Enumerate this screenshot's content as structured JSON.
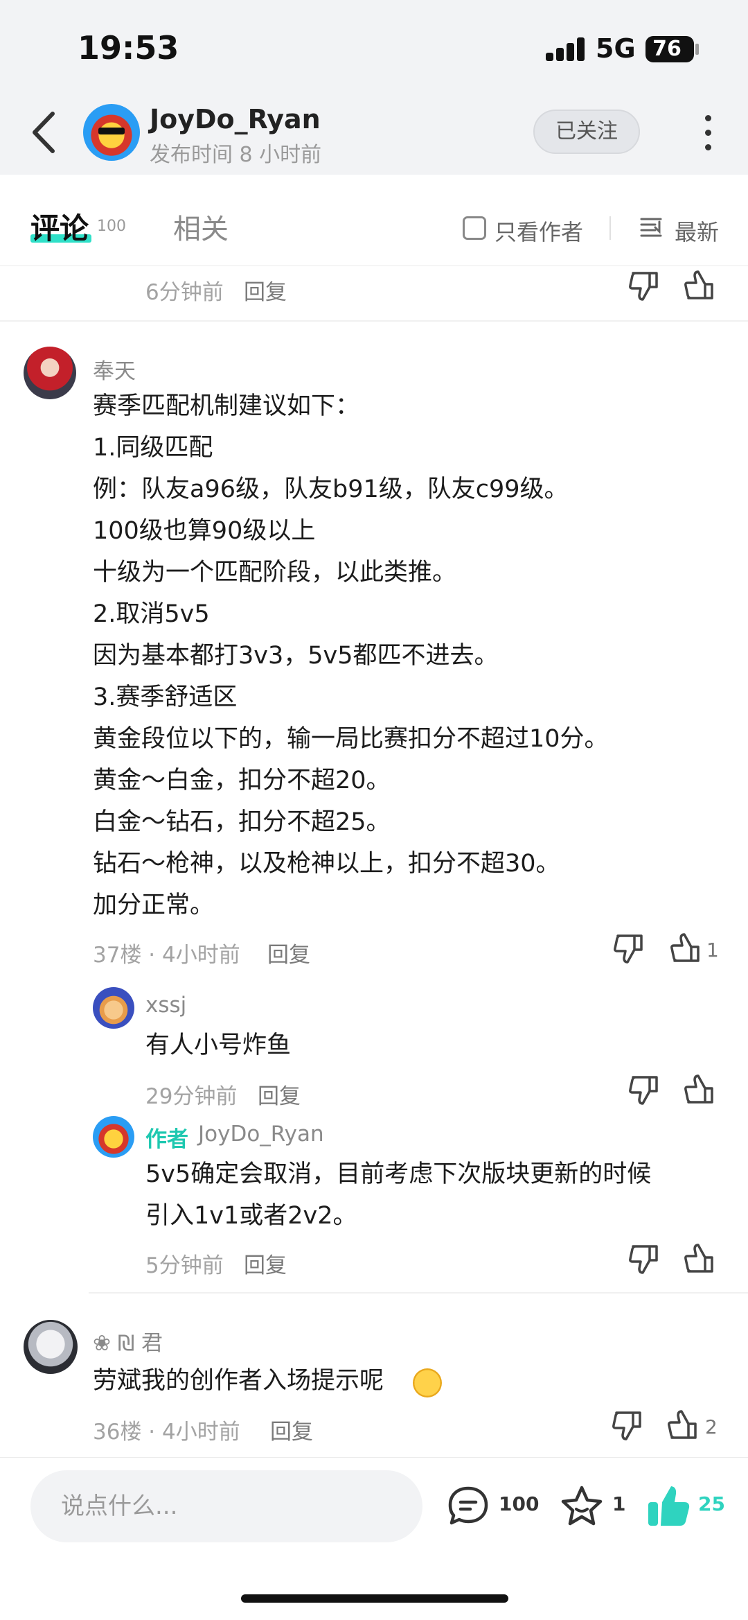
{
  "status_bar": {
    "time": "19:53",
    "network": "5G",
    "battery": "76"
  },
  "header": {
    "author_name": "JoyDo_Ryan",
    "published": "发布时间 8 小时前",
    "follow_label": "已关注"
  },
  "tabs": {
    "comments_label": "评论",
    "comments_count": "100",
    "related_label": "相关",
    "only_author_label": "只看作者",
    "sort_label": "最新"
  },
  "top_partial_reply": {
    "time": "6分钟前",
    "reply_label": "回复"
  },
  "comments": [
    {
      "author": "奉天",
      "lines": [
        "赛季匹配机制建议如下：",
        "1.同级匹配",
        "例：队友a96级，队友b91级，队友c99级。",
        "100级也算90级以上",
        "十级为一个匹配阶段，以此类推。",
        "2.取消5v5",
        "因为基本都打3v3，5v5都匹不进去。",
        "3.赛季舒适区",
        "黄金段位以下的，输一局比赛扣分不超过10分。",
        "黄金～白金，扣分不超20。",
        "白金～钻石，扣分不超25。",
        "钻石～枪神，以及枪神以上，扣分不超30。",
        "加分正常。"
      ],
      "meta": "37楼 · 4小时前",
      "reply_label": "回复",
      "likes": "1",
      "replies": [
        {
          "author": "xssj",
          "text": "有人小号炸鱼",
          "time": "29分钟前",
          "reply_label": "回复"
        },
        {
          "author_badge": "作者",
          "author": "JoyDo_Ryan",
          "lines": [
            "5v5确定会取消，目前考虑下次版块更新的时候",
            "引入1v1或者2v2。"
          ],
          "time": "5分钟前",
          "reply_label": "回复"
        }
      ]
    },
    {
      "author": "❀ ₪ 君",
      "text": "劳斌我的创作者入场提示呢",
      "meta": "36楼 · 4小时前",
      "reply_label": "回复",
      "likes": "2"
    }
  ],
  "bottom_bar": {
    "input_placeholder": "说点什么...",
    "comment_count": "100",
    "favorite_count": "1",
    "like_count": "25"
  },
  "colors": {
    "accent": "#2fd3bf",
    "author_badge": "#1ec8b0"
  },
  "icons": [
    "back-icon",
    "more-icon",
    "checkbox-icon",
    "sort-icon",
    "dislike-icon",
    "like-icon",
    "comment-icon",
    "star-icon",
    "thumbs-up-filled-icon"
  ]
}
